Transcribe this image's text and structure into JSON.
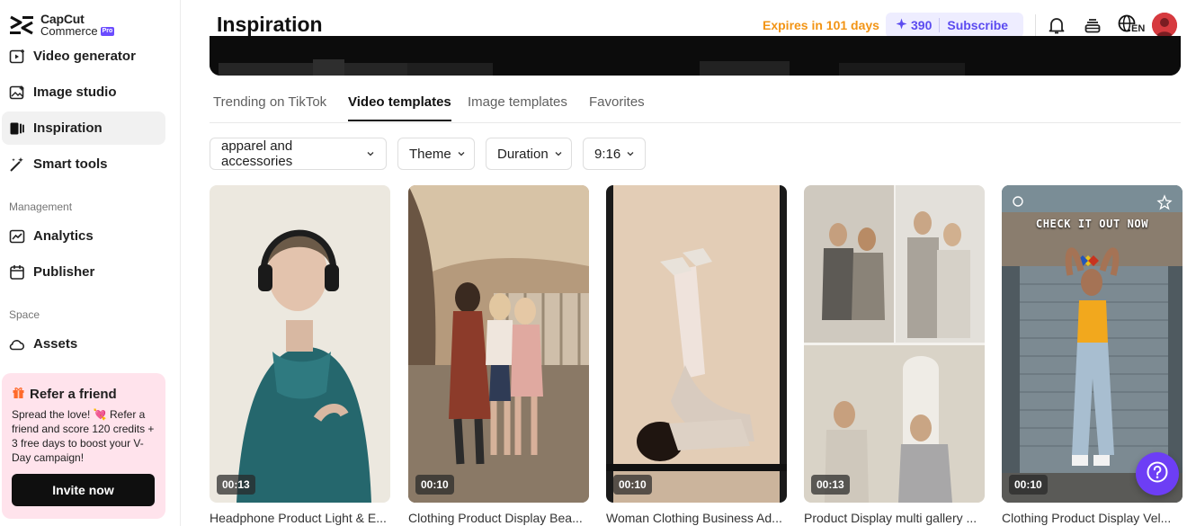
{
  "brand": {
    "name_line1": "CapCut",
    "name_line2": "Commerce",
    "badge": "Pro"
  },
  "sidebar": {
    "items": [
      {
        "label": "Video generator",
        "icon": "video-generator-icon"
      },
      {
        "label": "Image studio",
        "icon": "image-studio-icon"
      },
      {
        "label": "Inspiration",
        "icon": "inspiration-icon",
        "active": true
      },
      {
        "label": "Smart tools",
        "icon": "magic-wand-icon"
      }
    ],
    "management_label": "Management",
    "management_items": [
      {
        "label": "Analytics",
        "icon": "analytics-icon"
      },
      {
        "label": "Publisher",
        "icon": "calendar-icon"
      }
    ],
    "space_label": "Space",
    "space_items": [
      {
        "label": "Assets",
        "icon": "cloud-icon"
      }
    ],
    "refer": {
      "title": "Refer a friend",
      "body": "Spread the love! 💘 Refer a friend and score 120 credits + 3 free days to boost your V-Day campaign!",
      "button": "Invite now"
    }
  },
  "header": {
    "title": "Inspiration",
    "expires": "Expires in 101 days",
    "credits": "390",
    "subscribe": "Subscribe",
    "language": "EN"
  },
  "tabs": [
    {
      "label": "Trending on TikTok",
      "active": false
    },
    {
      "label": "Video templates",
      "active": true
    },
    {
      "label": "Image templates",
      "active": false
    },
    {
      "label": "Favorites",
      "active": false
    }
  ],
  "filters": [
    {
      "label": "apparel and accessories"
    },
    {
      "label": "Theme"
    },
    {
      "label": "Duration"
    },
    {
      "label": "9:16"
    }
  ],
  "cards": [
    {
      "duration": "00:13",
      "title": "Headphone Product Light & E..."
    },
    {
      "duration": "00:10",
      "title": "Clothing Product Display Bea..."
    },
    {
      "duration": "00:10",
      "title": "Woman Clothing Business Ad..."
    },
    {
      "duration": "00:13",
      "title": "Product Display multi gallery ..."
    },
    {
      "duration": "00:10",
      "title": "Clothing Product Display Vel...",
      "overlay_text": "CHECK IT OUT NOW"
    }
  ],
  "colors": {
    "accent": "#6b4dff",
    "expires": "#f29415",
    "refer_bg": "#ffe3ec",
    "help_button": "#6d3ef5"
  }
}
